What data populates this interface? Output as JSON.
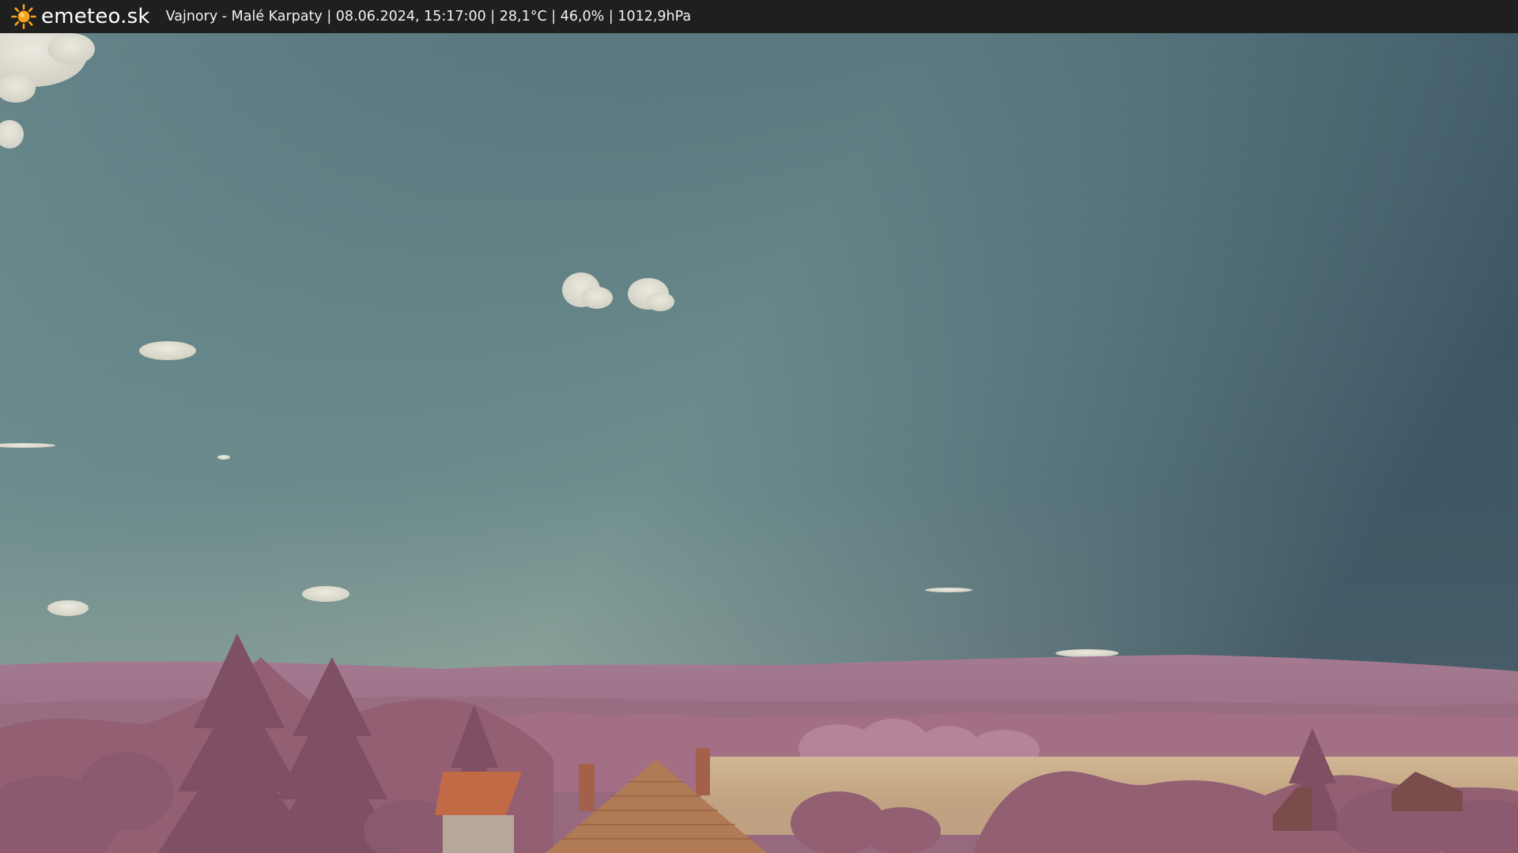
{
  "header": {
    "brand": "emeteo.sk",
    "brand_icon": "sun-icon",
    "caption": "Vajnory - Malé Karpaty | 08.06.2024, 15:17:00 | 28,1°C | 46,0% | 1012,9hPa"
  },
  "colors": {
    "bar_background": "#1f1f1f",
    "sun": "#f7a21b",
    "sky_top_right": "#3d5566",
    "sky_left": "#6a8c90",
    "sky_horizon": "#a7b4a2",
    "hills": "#a67a8e",
    "foliage": "#9a6679",
    "field": "#cbb08c",
    "roof": "#b07a55"
  }
}
